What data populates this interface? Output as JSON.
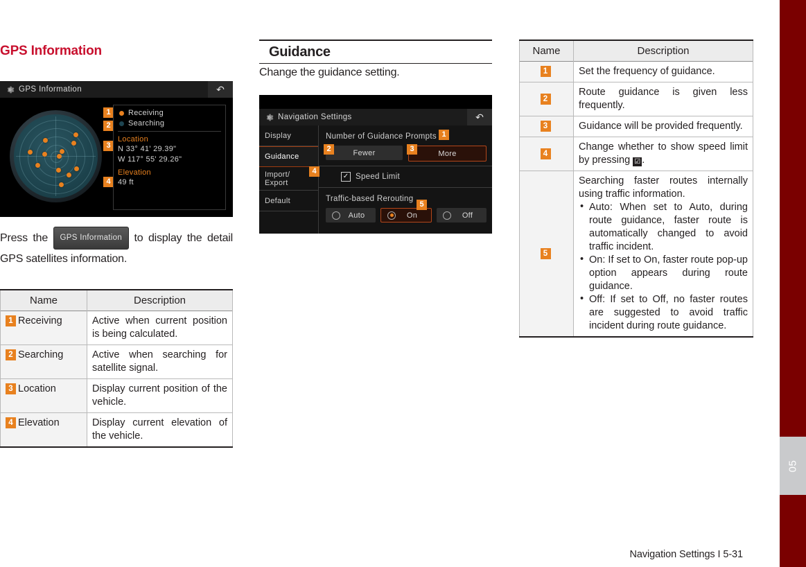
{
  "page": {
    "footer_text": "Navigation Settings I 5-31",
    "chapter_tab": "05",
    "accent_red": "#c8102e",
    "accent_orange": "#e8811f",
    "edge_bar_color": "#7a0000"
  },
  "column_left": {
    "heading": "GPS Information",
    "screenshot": {
      "title": "GPS Information",
      "gear_icon": "gear-icon",
      "back_icon": "back-arrow-icon",
      "legend": [
        {
          "badge": "1",
          "label": "Receiving",
          "state": "on"
        },
        {
          "badge": "2",
          "label": "Searching",
          "state": "off"
        }
      ],
      "location": {
        "badge": "3",
        "title": "Location",
        "latitude": "N 33° 41' 29.39\"",
        "longitude": "W 117° 55' 29.26\""
      },
      "elevation": {
        "badge": "4",
        "title": "Elevation",
        "value": "49 ft"
      }
    },
    "body_before": "Press the",
    "body_button": "GPS Information",
    "body_after": "to display the detail GPS satellites information.",
    "table": {
      "headers": [
        "Name",
        "Description"
      ],
      "rows": [
        {
          "badge": "1",
          "name": "Receiving",
          "description": "Active when current position is being calculated."
        },
        {
          "badge": "2",
          "name": "Searching",
          "description": "Active when searching for satellite signal."
        },
        {
          "badge": "3",
          "name": "Location",
          "description": "Display current position of the vehicle."
        },
        {
          "badge": "4",
          "name": "Elevation",
          "description": "Display current elevation of the vehicle."
        }
      ]
    }
  },
  "column_mid": {
    "heading": "Guidance",
    "intro": "Change the guidance setting.",
    "screenshot": {
      "title": "Navigation Settings",
      "gear_icon": "gear-icon",
      "back_icon": "back-arrow-icon",
      "menu": [
        {
          "label": "Display",
          "selected": false
        },
        {
          "label": "Guidance",
          "selected": true
        },
        {
          "label": "Import/\nExport",
          "selected": false
        },
        {
          "label": "Default",
          "selected": false
        }
      ],
      "prompts": {
        "label": "Number of Guidance Prompts",
        "badge": "1",
        "options": [
          {
            "badge": "2",
            "label": "Fewer",
            "active": false
          },
          {
            "badge": "3",
            "label": "More",
            "active": true
          }
        ]
      },
      "speed_limit": {
        "badge": "4",
        "label": "Speed Limit",
        "checked": true,
        "check_glyph": "☑"
      },
      "rerouting": {
        "label": "Traffic-based Rerouting",
        "badge": "5",
        "options": [
          {
            "label": "Auto",
            "selected": false
          },
          {
            "label": "On",
            "selected": true
          },
          {
            "label": "Off",
            "selected": false
          }
        ]
      }
    }
  },
  "column_right": {
    "table": {
      "headers": [
        "Name",
        "Description"
      ],
      "rows": [
        {
          "badge": "1",
          "description": "Set the frequency of guidance."
        },
        {
          "badge": "2",
          "description": "Route guidance is given less frequently."
        },
        {
          "badge": "3",
          "description": "Guidance will be provided frequently."
        },
        {
          "badge": "4",
          "description_before": "Change whether to show speed limit by pressing",
          "description_icon": "☑",
          "description_after": "."
        },
        {
          "badge": "5",
          "description_intro": "Searching faster routes internally using traffic information.",
          "bullets": [
            "Auto: When set to Auto, during route guidance, faster route is automatically changed to avoid traffic incident.",
            "On: If set to On, faster route pop-up option appears during route guidance.",
            "Off: If set to Off, no faster routes are suggested to avoid traffic incident during route guidance."
          ]
        }
      ]
    }
  }
}
